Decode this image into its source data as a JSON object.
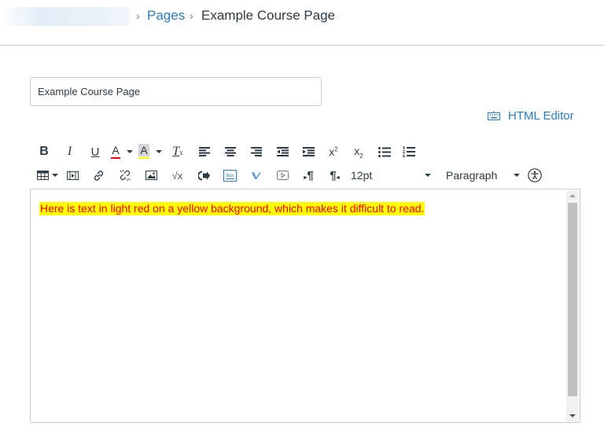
{
  "breadcrumb": {
    "separator": "›",
    "pages": "Pages",
    "current": "Example Course Page"
  },
  "title_input": {
    "value": "Example Course Page"
  },
  "html_editor": {
    "label": "HTML Editor",
    "icon": "keyboard-icon"
  },
  "toolbar": {
    "row1": [
      {
        "name": "bold",
        "glyph": "B"
      },
      {
        "name": "italic",
        "glyph": "I"
      },
      {
        "name": "underline",
        "glyph": "U"
      },
      {
        "name": "text-color",
        "glyph": "A"
      },
      {
        "name": "background-color",
        "glyph": "A"
      },
      {
        "name": "clear-formatting",
        "glyph": "T"
      },
      {
        "name": "align-left"
      },
      {
        "name": "align-center"
      },
      {
        "name": "align-right"
      },
      {
        "name": "outdent"
      },
      {
        "name": "indent"
      },
      {
        "name": "superscript",
        "glyph": "x"
      },
      {
        "name": "subscript",
        "glyph": "x"
      },
      {
        "name": "bullet-list"
      },
      {
        "name": "numbered-list"
      }
    ],
    "font_size": "12pt",
    "block_format": "Paragraph",
    "accent_color": "#2d3b45",
    "text_color_underline": "#ff0000",
    "bg_color_underline": "#ffff00"
  },
  "editor": {
    "content": "Here is text in light red on a yellow background, which makes it difficult to read.",
    "text_color": "#ff0000",
    "background_color": "#ffff00"
  },
  "colors": {
    "link": "#2b7abc",
    "text": "#2d3b45",
    "border": "#c7cdd1"
  }
}
